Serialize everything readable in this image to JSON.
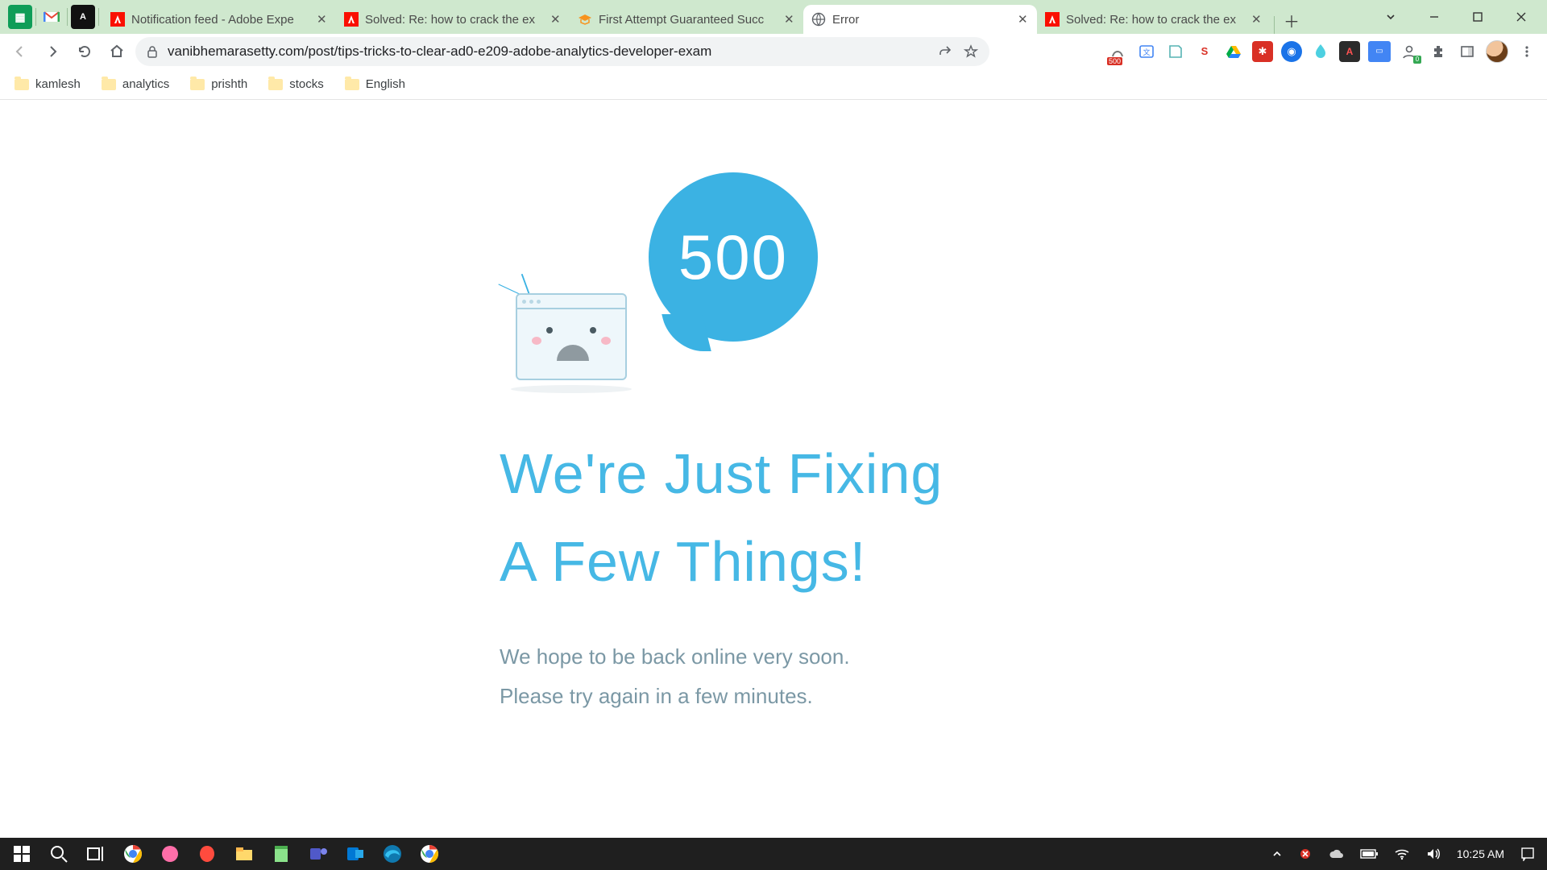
{
  "tabs": [
    {
      "label": "Notification feed - Adobe Expe"
    },
    {
      "label": "Solved: Re: how to crack the ex"
    },
    {
      "label": "First Attempt Guaranteed Succ"
    },
    {
      "label": "Error"
    },
    {
      "label": "Solved: Re: how to crack the ex"
    }
  ],
  "address": {
    "url": "vanibhemarasetty.com/post/tips-tricks-to-clear-ad0-e209-adobe-analytics-developer-exam"
  },
  "bookmarks": [
    {
      "label": "kamlesh"
    },
    {
      "label": "analytics"
    },
    {
      "label": "prishth"
    },
    {
      "label": "stocks"
    },
    {
      "label": "English"
    }
  ],
  "error": {
    "code": "500",
    "headline_line1": "We're Just Fixing",
    "headline_line2": "A Few Things!",
    "sub_line1": "We hope to be back online very soon.",
    "sub_line2": "Please try again in a few minutes."
  },
  "extension_badge": "500",
  "taskbar": {
    "time": "10:25 AM"
  }
}
